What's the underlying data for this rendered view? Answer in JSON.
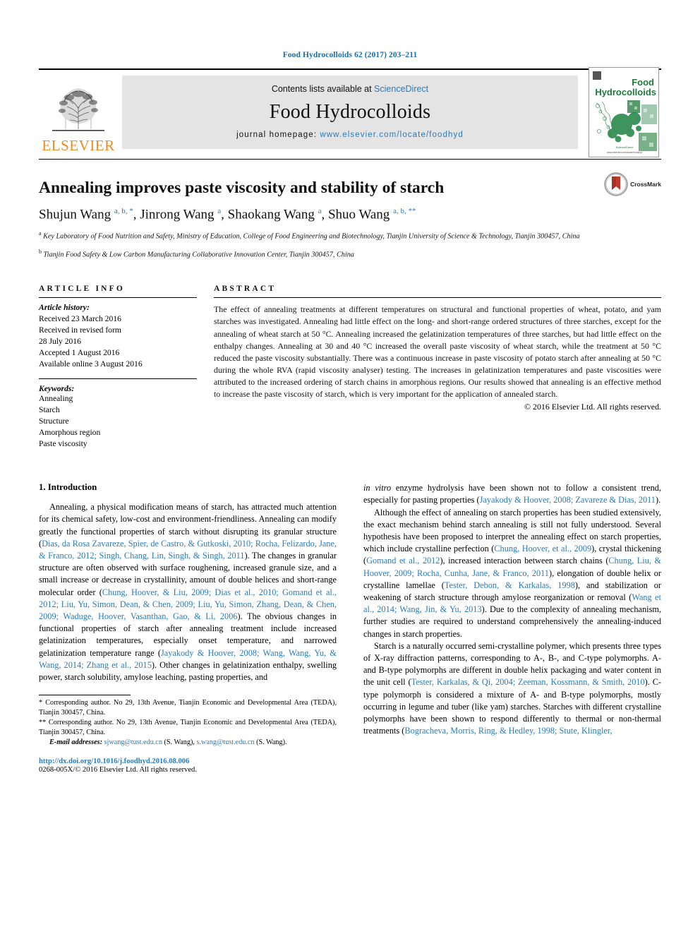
{
  "running_head": "Food Hydrocolloids 62 (2017) 203–211",
  "masthead": {
    "publisher": "ELSEVIER",
    "contents_prefix": "Contents lists available at ",
    "contents_link": "ScienceDirect",
    "journal_name": "Food Hydrocolloids",
    "homepage_label": "journal homepage: ",
    "homepage_url": "www.elsevier.com/locate/foodhyd",
    "cover_title_line1": "Food",
    "cover_title_line2": "Hydrocolloids"
  },
  "article": {
    "title": "Annealing improves paste viscosity and stability of starch",
    "authors_html": "Shujun Wang <sup>a, b, *</sup>, Jinrong Wang <sup>a</sup>, Shaokang Wang <sup>a</sup>, Shuo Wang <sup>a, b, **</sup>",
    "affiliation_a": "Key Laboratory of Food Nutrition and Safety, Ministry of Education, College of Food Engineering and Biotechnology, Tianjin University of Science & Technology, Tianjin 300457, China",
    "affiliation_b": "Tianjin Food Safety & Low Carbon Manufacturing Collaborative Innovation Center, Tianjin 300457, China",
    "crossmark_label": "CrossMark"
  },
  "article_info": {
    "heading": "ARTICLE INFO",
    "history_label": "Article history:",
    "history": [
      "Received 23 March 2016",
      "Received in revised form",
      "28 July 2016",
      "Accepted 1 August 2016",
      "Available online 3 August 2016"
    ],
    "keywords_label": "Keywords:",
    "keywords": [
      "Annealing",
      "Starch",
      "Structure",
      "Amorphous region",
      "Paste viscosity"
    ]
  },
  "abstract": {
    "heading": "ABSTRACT",
    "text": "The effect of annealing treatments at different temperatures on structural and functional properties of wheat, potato, and yam starches was investigated. Annealing had little effect on the long- and short-range ordered structures of three starches, except for the annealing of wheat starch at 50 °C. Annealing increased the gelatinization temperatures of three starches, but had little effect on the enthalpy changes. Annealing at 30 and 40 °C increased the overall paste viscosity of wheat starch, while the treatment at 50 °C reduced the paste viscosity substantially. There was a continuous increase in paste viscosity of potato starch after annealing at 50 °C during the whole RVA (rapid viscosity analyser) testing. The increases in gelatinization temperatures and paste viscosities were attributed to the increased ordering of starch chains in amorphous regions. Our results showed that annealing is an effective method to increase the paste viscosity of starch, which is very important for the application of annealed starch.",
    "copyright": "© 2016 Elsevier Ltd. All rights reserved."
  },
  "introduction": {
    "heading": "1. Introduction",
    "para1_part1": "Annealing, a physical modification means of starch, has attracted much attention for its chemical safety, low-cost and environment-friendliness. Annealing can modify greatly the functional properties of starch without disrupting its granular structure (",
    "cite1": "Dias, da Rosa Zavareze, Spier, de Castro, & Gutkoski, 2010; Rocha, Felizardo, Jane, & Franco, 2012; Singh, Chang, Lin, Singh, & Singh, 2011",
    "para1_part2": "). The changes in granular structure are often observed with surface roughening, increased granule size, and a small increase or decrease in crystallinity, amount of double helices and short-range molecular order (",
    "cite2": "Chung, Hoover, & Liu, 2009; Dias et al., 2010; Gomand et al., 2012; Liu, Yu, Simon, Dean, & Chen, 2009; Liu, Yu, Simon, Zhang, Dean, & Chen, 2009; Waduge, Hoover, Vasanthan, Gao, & Li, 2006",
    "para1_part3": "). The obvious changes in functional properties of starch after annealing treatment include increased gelatinization temperatures, especially onset temperature, and narrowed gelatinization temperature range (",
    "cite3": "Jayakody & Hoover, 2008; Wang, Wang, Yu, & Wang, 2014; Zhang et al., 2015",
    "para1_part4": "). Other changes in gelatinization enthalpy, swelling power, starch solubility, amylose leaching, pasting properties, and ",
    "para1_italic": "in vitro",
    "para1_part5": " enzyme hydrolysis have been shown not to follow a consistent trend, especially for pasting properties (",
    "cite4": "Jayakody & Hoover, 2008; Zavareze & Dias, 2011",
    "para1_part6": ").",
    "para2_part1": "Although the effect of annealing on starch properties has been studied extensively, the exact mechanism behind starch annealing is still not fully understood. Several hypothesis have been proposed to interpret the annealing effect on starch properties, which include crystalline perfection (",
    "cite5": "Chung, Hoover, et al., 2009",
    "para2_part2": "), crystal thickening (",
    "cite6": "Gomand et al., 2012",
    "para2_part3": "), increased interaction between starch chains (",
    "cite7": "Chung, Liu, & Hoover, 2009; Rocha, Cunha, Jane, & Franco, 2011",
    "para2_part4": "), elongation of double helix or crystalline lamellae (",
    "cite8": "Tester, Debon, & Karkalas, 1998",
    "para2_part5": "), and stabilization or weakening of starch structure through amylose reorganization or removal (",
    "cite9": "Wang et al., 2014; Wang, Jin, & Yu, 2013",
    "para2_part6": "). Due to the complexity of annealing mechanism, further studies are required to understand comprehensively the annealing-induced changes in starch properties.",
    "para3_part1": "Starch is a naturally occurred semi-crystalline polymer, which presents three types of X-ray diffraction patterns, corresponding to A-, B-, and C-type polymorphs. A- and B-type polymorphs are different in double helix packaging and water content in the unit cell (",
    "cite10": "Tester, Karkalas, & Qi, 2004; Zeeman, Kossmann, & Smith, 2010",
    "para3_part2": "). C-type polymorph is considered a mixture of A- and B-type polymorphs, mostly occurring in legume and tuber (like yam) starches. Starches with different crystalline polymorphs have been shown to respond differently to thermal or non-thermal treatments (",
    "cite11": "Bogracheva, Morris, Ring, & Hedley, 1998; Stute, Klingler,"
  },
  "footnotes": {
    "star": "* Corresponding author. No 29, 13th Avenue, Tianjin Economic and Developmental Area (TEDA), Tianjin 300457, China.",
    "doublestar": "** Corresponding author. No 29, 13th Avenue, Tianjin Economic and Developmental Area (TEDA), Tianjin 300457, China.",
    "email_label": "E-mail addresses:",
    "email1": "sjwang@tust.edu.cn",
    "email1_name": "(S. Wang),",
    "email2": "s.wang@tust.edu.cn",
    "email2_name": "(S. Wang).",
    "doi": "http://dx.doi.org/10.1016/j.foodhyd.2016.08.006",
    "issn": "0268-005X/© 2016 Elsevier Ltd. All rights reserved."
  },
  "colors": {
    "link_blue": "#2b7bba",
    "running_head_blue": "#1a6ea8",
    "elsevier_orange": "#f08a1e",
    "cover_green": "#1e7a3c",
    "crossmark_red": "#c0392b"
  }
}
